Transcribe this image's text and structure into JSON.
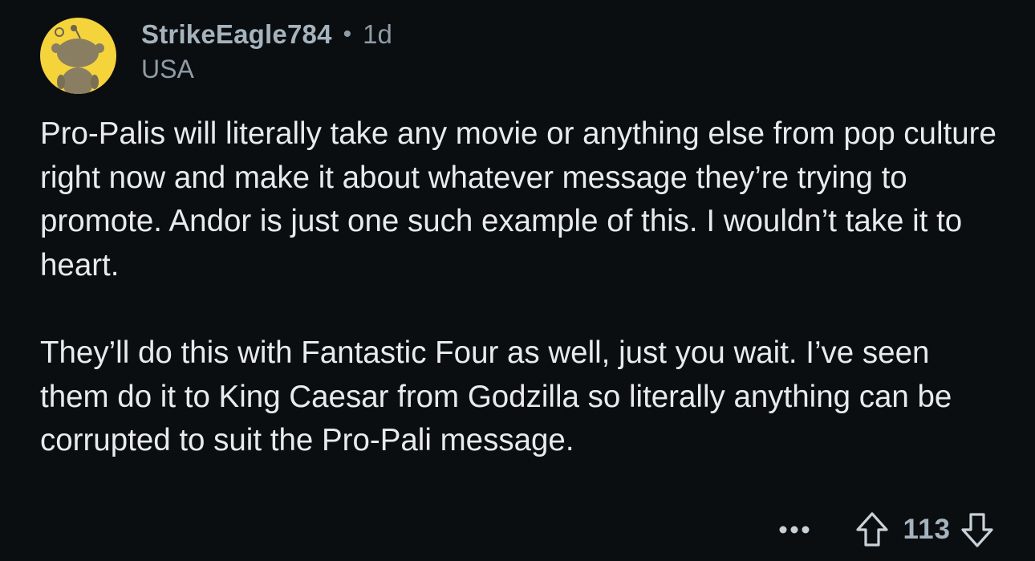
{
  "comment": {
    "author": "StrikeEagle784",
    "separator": "•",
    "age": "1d",
    "flair": "USA",
    "paragraphs": [
      "Pro-Palis will literally take any movie or anything else from pop culture right now and make it about whatever message they’re trying to promote. Andor is just one such example of this. I wouldn’t take it to heart.",
      "They’ll do this with Fantastic Four as well, just you wait. I’ve seen them do it to King Caesar from Godzilla so literally anything can be corrupted to suit the Pro-Pali message."
    ],
    "score": "113"
  },
  "icons": {
    "avatar": "snoo-avatar",
    "more": "more-options-icon",
    "upvote": "upvote-arrow-icon",
    "downvote": "downvote-arrow-icon"
  },
  "colors": {
    "background": "#0b0e11",
    "text": "#e8ebee",
    "meta": "#a5b3bd",
    "avatar_bg": "#f5d33b"
  }
}
